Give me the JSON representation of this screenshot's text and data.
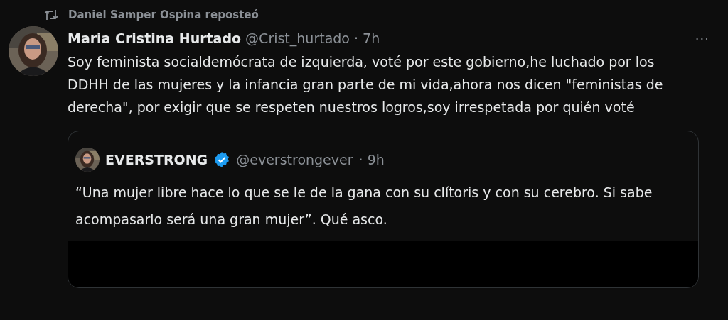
{
  "repost": {
    "text": "Daniel Samper Ospina reposteó"
  },
  "post": {
    "name": "Maria Cristina Hurtado",
    "handle": "@Crist_hurtado",
    "time": "· 7h",
    "more": "···",
    "text": "Soy feminista socialdemócrata de izquierda, voté por este gobierno,he luchado por los DDHH de las mujeres y la infancia gran parte de mi vida,ahora nos dicen \"feministas de derecha\", por exigir que se respeten nuestros logros,soy irrespetada por quién voté",
    "quote": {
      "name": "EVERSTRONG",
      "verified": true,
      "handle": "@everstrongever",
      "time": "· 9h",
      "text": "“Una mujer libre hace lo que se le de la gana con su clítoris y con su cerebro.  Si sabe acompasarlo será una gran mujer”.  Qué asco."
    }
  }
}
